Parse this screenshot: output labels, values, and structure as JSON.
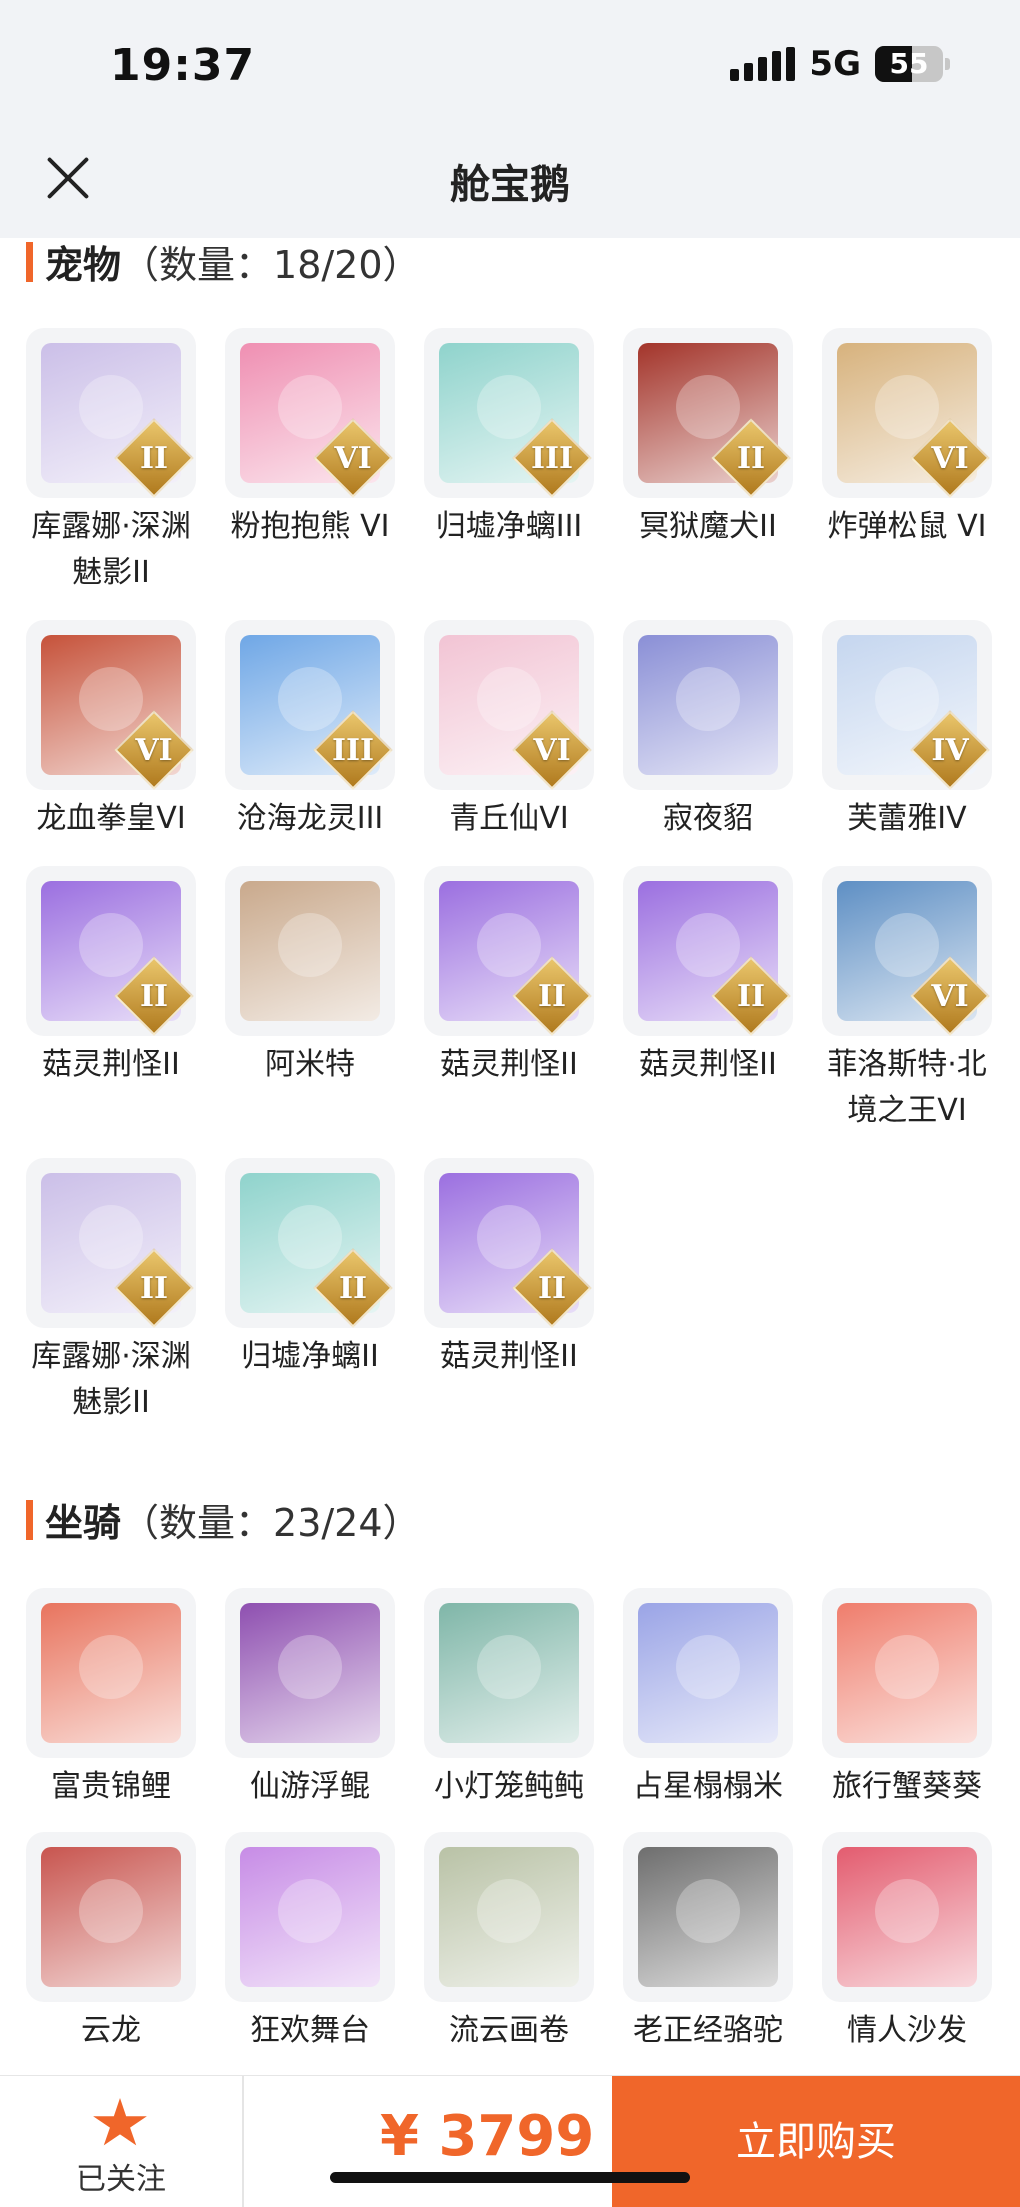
{
  "status_bar": {
    "time": "19:37",
    "network": "5G",
    "battery": "55"
  },
  "header": {
    "title": "舱宝鹅"
  },
  "pets": {
    "title": "宠物",
    "count": "（数量：18/20）",
    "items": [
      {
        "label": "库露娜·深渊魅影II",
        "grade": "II",
        "color": "#cbbfe8"
      },
      {
        "label": "粉抱抱熊 VI",
        "grade": "VI",
        "color": "#ef8fb2"
      },
      {
        "label": "归墟净螭III",
        "grade": "III",
        "color": "#8fd3cc"
      },
      {
        "label": "冥狱魔犬II",
        "grade": "II",
        "color": "#a3342a"
      },
      {
        "label": "炸弹松鼠 VI",
        "grade": "VI",
        "color": "#d7b27d"
      },
      {
        "label": "龙血拳皇VI",
        "grade": "VI",
        "color": "#c6523a"
      },
      {
        "label": "沧海龙灵III",
        "grade": "III",
        "color": "#6fa7e6"
      },
      {
        "label": "青丘仙VI",
        "grade": "VI",
        "color": "#f2c4d4"
      },
      {
        "label": "寂夜貂",
        "grade": "",
        "color": "#8a8fd6"
      },
      {
        "label": "芙蕾雅IV",
        "grade": "IV",
        "color": "#c5d6ef"
      },
      {
        "label": "菇灵荆怪II",
        "grade": "II",
        "color": "#9b6fe0"
      },
      {
        "label": "阿米特",
        "grade": "",
        "color": "#c9a98c"
      },
      {
        "label": "菇灵荆怪II",
        "grade": "II",
        "color": "#9b6fe0"
      },
      {
        "label": "菇灵荆怪II",
        "grade": "II",
        "color": "#9b6fe0"
      },
      {
        "label": "菲洛斯特·北境之王VI",
        "grade": "VI",
        "color": "#5e8fc4"
      },
      {
        "label": "库露娜·深渊魅影II",
        "grade": "II",
        "color": "#cbbfe8"
      },
      {
        "label": "归墟净螭II",
        "grade": "II",
        "color": "#8fd3cc"
      },
      {
        "label": "菇灵荆怪II",
        "grade": "II",
        "color": "#9b6fe0"
      }
    ]
  },
  "mounts": {
    "title": "坐骑",
    "count": "（数量：23/24）",
    "items": [
      {
        "label": "富贵锦鲤",
        "color": "#e8745e"
      },
      {
        "label": "仙游浮鲲",
        "color": "#8e4fb0"
      },
      {
        "label": "小灯笼鲀鲀",
        "color": "#7fb6a8"
      },
      {
        "label": "占星榻榻米",
        "color": "#9aa4e6"
      },
      {
        "label": "旅行蟹葵葵",
        "color": "#ef7d6c"
      },
      {
        "label": "云龙",
        "color": "#c8554f"
      },
      {
        "label": "狂欢舞台",
        "color": "#c78ce6"
      },
      {
        "label": "流云画卷",
        "color": "#b9c2a6"
      },
      {
        "label": "老正经骆驼",
        "color": "#6e6e6e"
      },
      {
        "label": "情人沙发",
        "color": "#e35c6f"
      }
    ]
  },
  "bottom_bar": {
    "follow_label": "已关注",
    "price": "¥ 3799",
    "buy_label": "立即购买"
  }
}
